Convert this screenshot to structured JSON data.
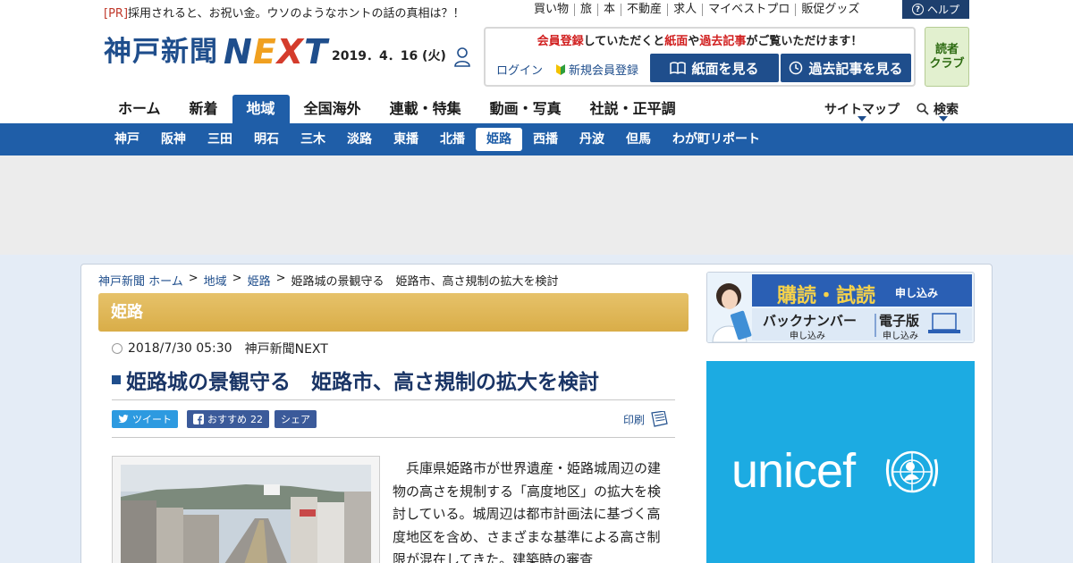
{
  "pr": {
    "tag": "[PR]",
    "text": "採用されると、お祝い金。ウソのようなホントの話の真相は？！"
  },
  "top_links": [
    "買い物",
    "旅",
    "本",
    "不動産",
    "求人",
    "マイベストプロ",
    "販促グッズ"
  ],
  "help_label": "ヘルプ",
  "logo": {
    "jp": "神戸新聞",
    "next": [
      "N",
      "E",
      "X",
      "T"
    ]
  },
  "date": "2019．4．16 (火)",
  "member": {
    "msg_parts": [
      {
        "t": "会員登録",
        "red": true
      },
      {
        "t": "していただくと",
        "red": false
      },
      {
        "t": "紙面",
        "red": true
      },
      {
        "t": "や",
        "red": false
      },
      {
        "t": "過去記事",
        "red": true
      },
      {
        "t": "がご覧いただけます！",
        "red": false
      }
    ],
    "login": "ログイン",
    "register": "新規会員登録",
    "btn_paper": "紙面を見る",
    "btn_archive": "過去記事を見る"
  },
  "club": [
    "読者",
    "クラブ"
  ],
  "main_nav": [
    "ホーム",
    "新着",
    "地域",
    "全国海外",
    "連載・特集",
    "動画・写真",
    "社説・正平調"
  ],
  "main_nav_active": 2,
  "sitemap": "サイトマップ",
  "search": "検索",
  "sub_nav": [
    "神戸",
    "阪神",
    "三田",
    "明石",
    "三木",
    "淡路",
    "東播",
    "北播",
    "姫路",
    "西播",
    "丹波",
    "但馬",
    "わが町リポート"
  ],
  "sub_nav_active": 8,
  "breadcrumb": [
    "神戸新聞 ホーム",
    "地域",
    "姫路",
    "姫路城の景観守る　姫路市、高さ規制の拡大を検討"
  ],
  "section": "姫路",
  "article": {
    "datetime": "2018/7/30 05:30",
    "source": "神戸新聞NEXT",
    "title": "姫路城の景観守る　姫路市、高さ規制の拡大を検討",
    "body": "兵庫県姫路市が世界遺産・姫路城周辺の建物の高さを規制する「高度地区」の拡大を検討している。城周辺は都市計画法に基づく高度地区を含め、さまざまな基準による高さ制限が混在してきた。建築時の審査"
  },
  "social": {
    "tweet": "ツイート",
    "recommend": "おすすめ",
    "recommend_count": "22",
    "share": "シェア",
    "print": "印刷"
  },
  "subscribe": {
    "title": "購読・試読",
    "title_suffix": "申し込み",
    "back": "バックナンバー",
    "back_sub": "申し込み",
    "digital": "電子版",
    "digital_sub": "申し込み"
  },
  "unicef": "unicef",
  "colors": {
    "brand_blue": "#1f5ea8",
    "dark_blue": "#1f4e8c",
    "section_gold": "#d9ad48",
    "unicef_blue": "#1cabe2",
    "red": "#d12020"
  }
}
